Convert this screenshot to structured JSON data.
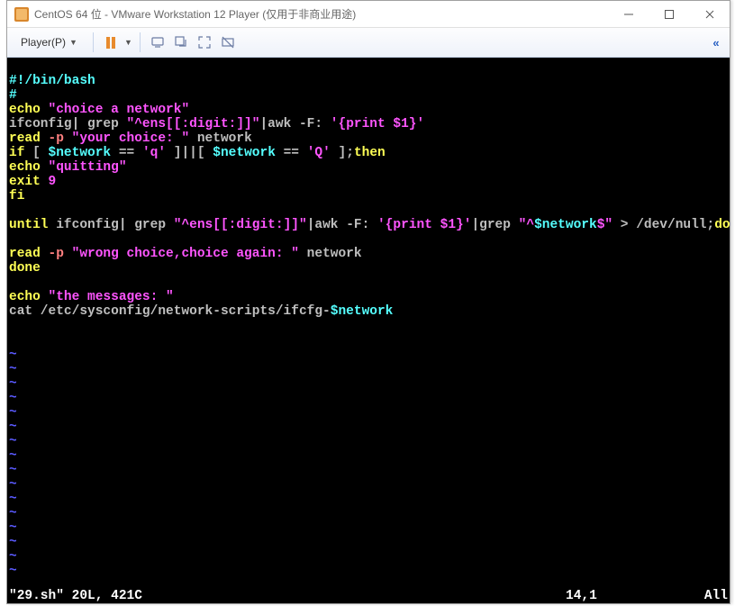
{
  "titlebar": {
    "title": "CentOS 64 位 - VMware Workstation 12 Player (仅用于非商业用途)"
  },
  "toolbar": {
    "player_label": "Player(P)"
  },
  "code": {
    "l1_shebang": "#!/bin/bash",
    "l2_hash": "#",
    "l3_echo": "echo ",
    "l3_str": "\"choice a network\"",
    "l4_a": "ifconfig| grep ",
    "l4_b": "\"^ens[[:digit:]]\"",
    "l4_c": "|awk -F: ",
    "l4_d": "'{print $1}'",
    "l5_a": "read ",
    "l5_b": "-p",
    "l5_c": " \"your choice: \"",
    "l5_d": " network",
    "l6_a": "if",
    "l6_b": " [ ",
    "l6_c": "$network",
    "l6_d": " == ",
    "l6_e": "'q'",
    "l6_f": " ]||[ ",
    "l6_g": "$network",
    "l6_h": " == ",
    "l6_i": "'Q'",
    "l6_j": " ];",
    "l6_k": "then",
    "l7_a": "echo ",
    "l7_b": "\"quitting\"",
    "l8_a": "exit",
    "l8_b": " 9",
    "l9": "fi",
    "l11_a": "until",
    "l11_b": " ifconfig| grep ",
    "l11_c": "\"^ens[[:digit:]]\"",
    "l11_d": "|awk -F: ",
    "l11_e": "'{print $1}'",
    "l11_f": "|grep ",
    "l11_g1": "\"^",
    "l11_g2": "$network",
    "l11_g3": "$\"",
    "l11_h": " > /dev/null;",
    "l11_i": "do",
    "l13_a": "read ",
    "l13_b": "-p",
    "l13_c": " \"wrong choice,choice again: \"",
    "l13_d": " network",
    "l14": "done",
    "l16_a": "echo ",
    "l16_b": "\"the messages: \"",
    "l17_a": "cat /etc/sysconfig/network-scripts/ifcfg-",
    "l17_b": "$network",
    "tilde": "~"
  },
  "status": {
    "left": "\"29.sh\" 20L, 421C",
    "mid": "14,1",
    "right": "All"
  }
}
